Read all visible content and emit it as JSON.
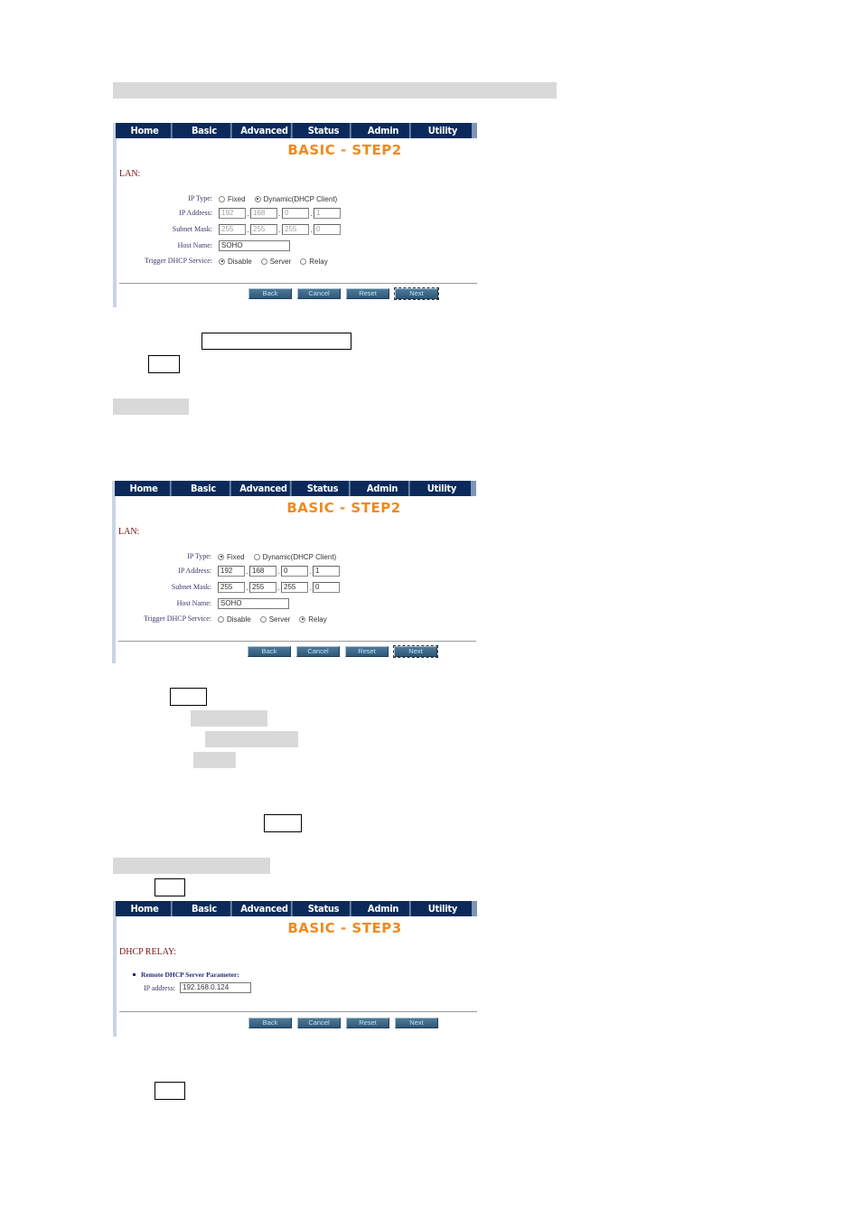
{
  "nav": [
    "Home",
    "Basic",
    "Advanced",
    "Status",
    "Admin",
    "Utility"
  ],
  "colors": {
    "nav_bg": "#0b2a5a",
    "title": "#f08a1c",
    "section_label": "#7a1010",
    "button_bg": "#3c6688",
    "button_text": "#bde4f4",
    "placeholder_bar": "#d9d9d9"
  },
  "panel1": {
    "title": "BASIC - STEP2",
    "section": "LAN:",
    "ip_type_label": "IP Type:",
    "ip_type_options": [
      "Fixed",
      "Dynamic(DHCP Client)"
    ],
    "ip_type_selected": "Dynamic(DHCP Client)",
    "ip_address_label": "IP Address:",
    "ip_address": [
      "192",
      "168",
      "0",
      "1"
    ],
    "subnet_mask_label": "Subnet Mask:",
    "subnet_mask": [
      "255",
      "255",
      "255",
      "0"
    ],
    "fields_disabled": true,
    "host_name_label": "Host Name:",
    "host_name": "SOHO",
    "dhcp_label": "Trigger DHCP Service:",
    "dhcp_options": [
      "Disable",
      "Server",
      "Relay"
    ],
    "dhcp_selected": "Disable",
    "buttons": [
      "Back",
      "Cancel",
      "Reset",
      "Next"
    ],
    "focused_button": "Next"
  },
  "panel2": {
    "title": "BASIC - STEP2",
    "section": "LAN:",
    "ip_type_label": "IP Type:",
    "ip_type_options": [
      "Fixed",
      "Dynamic(DHCP Client)"
    ],
    "ip_type_selected": "Fixed",
    "ip_address_label": "IP Address:",
    "ip_address": [
      "192",
      "168",
      "0",
      "1"
    ],
    "subnet_mask_label": "Subnet Mask:",
    "subnet_mask": [
      "255",
      "255",
      "255",
      "0"
    ],
    "fields_disabled": false,
    "host_name_label": "Host Name:",
    "host_name": "SOHO",
    "dhcp_label": "Trigger DHCP Service:",
    "dhcp_options": [
      "Disable",
      "Server",
      "Relay"
    ],
    "dhcp_selected": "Relay",
    "buttons": [
      "Back",
      "Cancel",
      "Reset",
      "Next"
    ],
    "focused_button": "Next"
  },
  "panel3": {
    "title": "BASIC - STEP3",
    "section": "DHCP RELAY:",
    "param_heading": "Remote DHCP Server Parameter:",
    "ip_label": "IP address:",
    "ip_value": "192.168.0.124",
    "buttons": [
      "Back",
      "Cancel",
      "Reset",
      "Next"
    ]
  }
}
